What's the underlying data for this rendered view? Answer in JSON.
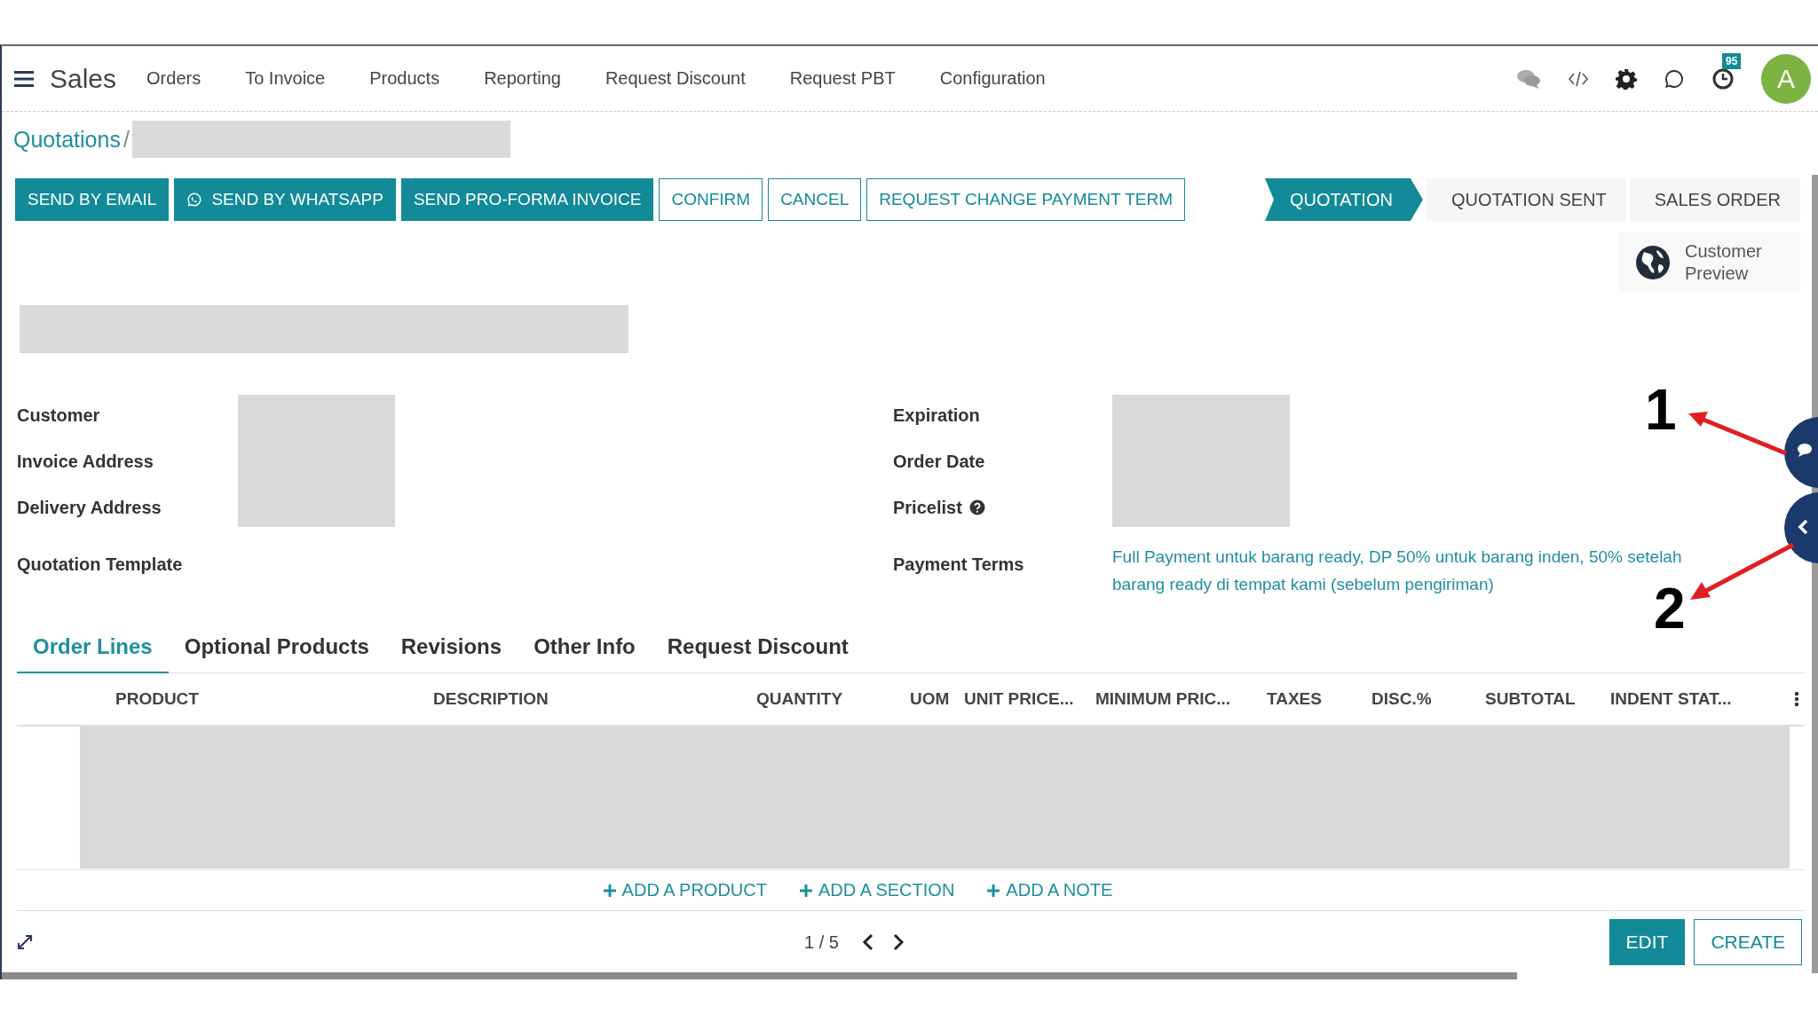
{
  "navbar": {
    "app_name": "Sales",
    "menu": [
      {
        "label": "Orders"
      },
      {
        "label": "To Invoice"
      },
      {
        "label": "Products"
      },
      {
        "label": "Reporting"
      },
      {
        "label": "Request Discount"
      },
      {
        "label": "Request PBT"
      },
      {
        "label": "Configuration"
      }
    ],
    "activity_count": "95",
    "avatar_letter": "A"
  },
  "breadcrumb": {
    "link": "Quotations",
    "separator": "/"
  },
  "action_buttons": [
    {
      "label": "SEND BY EMAIL",
      "primary": true,
      "kind": "plain"
    },
    {
      "label": "SEND BY WHATSAPP",
      "primary": true,
      "kind": "whatsapp"
    },
    {
      "label": "SEND PRO-FORMA INVOICE",
      "primary": true,
      "kind": "plain"
    },
    {
      "label": "CONFIRM",
      "primary": false,
      "kind": "plain"
    },
    {
      "label": "CANCEL",
      "primary": false,
      "kind": "plain"
    },
    {
      "label": "REQUEST CHANGE PAYMENT TERM",
      "primary": false,
      "kind": "plain"
    }
  ],
  "status_steps": [
    {
      "label": "QUOTATION",
      "selected": true
    },
    {
      "label": "QUOTATION SENT",
      "selected": false
    },
    {
      "label": "SALES ORDER",
      "selected": false
    }
  ],
  "customer_preview": {
    "label": "Customer Preview"
  },
  "fields_left": [
    {
      "label": "Customer"
    },
    {
      "label": "Invoice Address"
    },
    {
      "label": "Delivery Address"
    },
    {
      "label": "Quotation Template"
    }
  ],
  "fields_right": [
    {
      "label": "Expiration",
      "help": false
    },
    {
      "label": "Order Date",
      "help": false
    },
    {
      "label": "Pricelist",
      "help": true
    },
    {
      "label": "Payment Terms",
      "help": false,
      "value": "Full Payment untuk barang ready, DP 50% untuk barang inden, 50% setelah barang ready di tempat kami (sebelum pengiriman)"
    }
  ],
  "tabs": [
    {
      "label": "Order Lines",
      "selected": true
    },
    {
      "label": "Optional Products",
      "selected": false
    },
    {
      "label": "Revisions",
      "selected": false
    },
    {
      "label": "Other Info",
      "selected": false
    },
    {
      "label": "Request Discount",
      "selected": false
    }
  ],
  "table": {
    "columns": [
      "PRODUCT",
      "DESCRIPTION",
      "QUANTITY",
      "UOM",
      "UNIT PRICE...",
      "MINIMUM PRIC...",
      "TAXES",
      "DISC.%",
      "SUBTOTAL",
      "INDENT STAT..."
    ],
    "add_actions": [
      {
        "label": "ADD A PRODUCT"
      },
      {
        "label": "ADD A SECTION"
      },
      {
        "label": "ADD A NOTE"
      }
    ]
  },
  "pager": {
    "value": "1 / 5"
  },
  "footer_buttons": [
    {
      "label": "EDIT",
      "primary": true
    },
    {
      "label": "CREATE",
      "primary": false
    }
  ],
  "annotations": [
    {
      "label": "1"
    },
    {
      "label": "2"
    }
  ]
}
